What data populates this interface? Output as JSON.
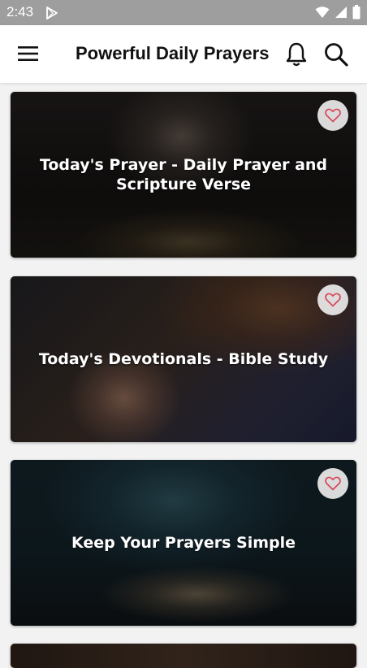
{
  "status_bar": {
    "time": "2:43"
  },
  "app_bar": {
    "title": "Powerful Daily Prayers",
    "menu_icon": "hamburger-menu-icon",
    "notification_icon": "bell-icon",
    "search_icon": "search-icon"
  },
  "cards": [
    {
      "title": "Today's Prayer - Daily Prayer and Scripture Verse",
      "favorite_icon": "heart-outline-icon"
    },
    {
      "title": "Today's Devotionals - Bible Study",
      "favorite_icon": "heart-outline-icon"
    },
    {
      "title": "Keep Your Prayers Simple",
      "favorite_icon": "heart-outline-icon"
    }
  ],
  "colors": {
    "status_bar": "#9e9e9e",
    "app_bar": "#ffffff",
    "heart": "#d9465a",
    "background": "#f2f2f2"
  }
}
